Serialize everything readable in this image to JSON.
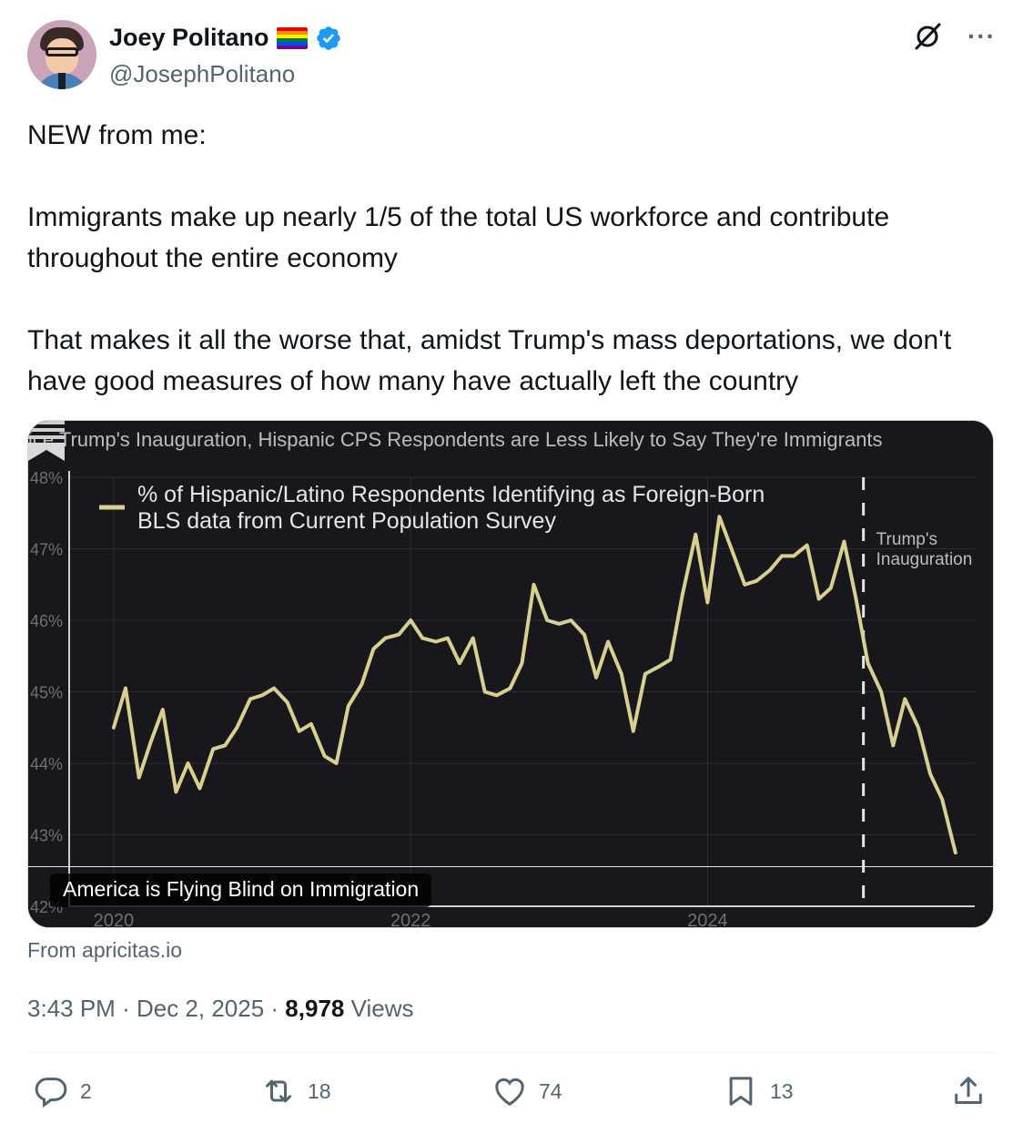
{
  "author": {
    "name": "Joey Politano",
    "handle": "@JosephPolitano",
    "flag_icon": "rainbow-flag-icon",
    "verified_icon": "verified-badge-icon",
    "verified_color": "#1d9bf0"
  },
  "top_actions": {
    "grok_icon": "grok-icon",
    "more_label": "···"
  },
  "tweet": {
    "paragraphs": [
      "NEW from me:",
      "Immigrants make up nearly 1/5 of the total US workforce and contribute throughout the entire economy",
      "That makes it all the worse that, amidst Trump's mass deportations, we don't have good measures of how many have actually left the country"
    ]
  },
  "card": {
    "label": "America is Flying Blind on Immigration",
    "source": "From apricitas.io",
    "bookmark_icon": "apricitas-logo-icon"
  },
  "meta": {
    "time": "3:43 PM",
    "date": "Dec 2, 2025",
    "views_count": "8,978",
    "views_label": "Views"
  },
  "actions": {
    "replies": "2",
    "reposts": "18",
    "likes": "74",
    "bookmarks": "13"
  },
  "chart_data": {
    "type": "line",
    "title": "ice Trump's Inauguration, Hispanic CPS Respondents are Less Likely to Say They're Immigrants",
    "legend": [
      "% of Hispanic/Latino Respondents Identifying as Foreign-Born",
      "BLS data from Current Population Survey"
    ],
    "y_ticks": [
      "48%",
      "47%",
      "46%",
      "45%",
      "44%",
      "43%",
      "42%"
    ],
    "x_ticks": [
      "2020",
      "2022",
      "2024"
    ],
    "ylim": [
      42,
      48
    ],
    "xlim": [
      2019.7,
      2025.8
    ],
    "series_color": "#d9cf8e",
    "background": "#17171c",
    "annotation": {
      "x": 2025.05,
      "label_line1": "Trump's",
      "label_line2": "Inauguration"
    },
    "series": [
      {
        "name": "% of Hispanic/Latino Respondents Identifying as Foreign-Born",
        "points": [
          [
            2020.0,
            44.5
          ],
          [
            2020.08,
            45.05
          ],
          [
            2020.17,
            43.8
          ],
          [
            2020.25,
            44.3
          ],
          [
            2020.33,
            44.75
          ],
          [
            2020.42,
            43.6
          ],
          [
            2020.5,
            44.0
          ],
          [
            2020.58,
            43.65
          ],
          [
            2020.67,
            44.2
          ],
          [
            2020.75,
            44.25
          ],
          [
            2020.83,
            44.5
          ],
          [
            2020.92,
            44.9
          ],
          [
            2021.0,
            44.95
          ],
          [
            2021.08,
            45.05
          ],
          [
            2021.17,
            44.85
          ],
          [
            2021.25,
            44.45
          ],
          [
            2021.33,
            44.55
          ],
          [
            2021.42,
            44.1
          ],
          [
            2021.5,
            44.0
          ],
          [
            2021.58,
            44.8
          ],
          [
            2021.67,
            45.1
          ],
          [
            2021.75,
            45.6
          ],
          [
            2021.83,
            45.75
          ],
          [
            2021.92,
            45.8
          ],
          [
            2022.0,
            46.0
          ],
          [
            2022.08,
            45.75
          ],
          [
            2022.17,
            45.7
          ],
          [
            2022.25,
            45.75
          ],
          [
            2022.33,
            45.4
          ],
          [
            2022.42,
            45.75
          ],
          [
            2022.5,
            45.0
          ],
          [
            2022.58,
            44.95
          ],
          [
            2022.67,
            45.05
          ],
          [
            2022.75,
            45.4
          ],
          [
            2022.83,
            46.5
          ],
          [
            2022.92,
            46.0
          ],
          [
            2023.0,
            45.95
          ],
          [
            2023.08,
            46.0
          ],
          [
            2023.17,
            45.8
          ],
          [
            2023.25,
            45.2
          ],
          [
            2023.33,
            45.7
          ],
          [
            2023.42,
            45.25
          ],
          [
            2023.5,
            44.45
          ],
          [
            2023.58,
            45.25
          ],
          [
            2023.67,
            45.35
          ],
          [
            2023.75,
            45.45
          ],
          [
            2023.83,
            46.35
          ],
          [
            2023.92,
            47.2
          ],
          [
            2024.0,
            46.25
          ],
          [
            2024.08,
            47.45
          ],
          [
            2024.17,
            46.95
          ],
          [
            2024.25,
            46.5
          ],
          [
            2024.33,
            46.55
          ],
          [
            2024.42,
            46.7
          ],
          [
            2024.5,
            46.9
          ],
          [
            2024.58,
            46.9
          ],
          [
            2024.67,
            47.05
          ],
          [
            2024.75,
            46.3
          ],
          [
            2024.83,
            46.45
          ],
          [
            2024.92,
            47.1
          ],
          [
            2025.0,
            46.3
          ],
          [
            2025.08,
            45.4
          ],
          [
            2025.17,
            45.0
          ],
          [
            2025.25,
            44.25
          ],
          [
            2025.33,
            44.9
          ],
          [
            2025.42,
            44.5
          ],
          [
            2025.5,
            43.85
          ],
          [
            2025.58,
            43.5
          ],
          [
            2025.67,
            42.75
          ]
        ]
      }
    ]
  }
}
